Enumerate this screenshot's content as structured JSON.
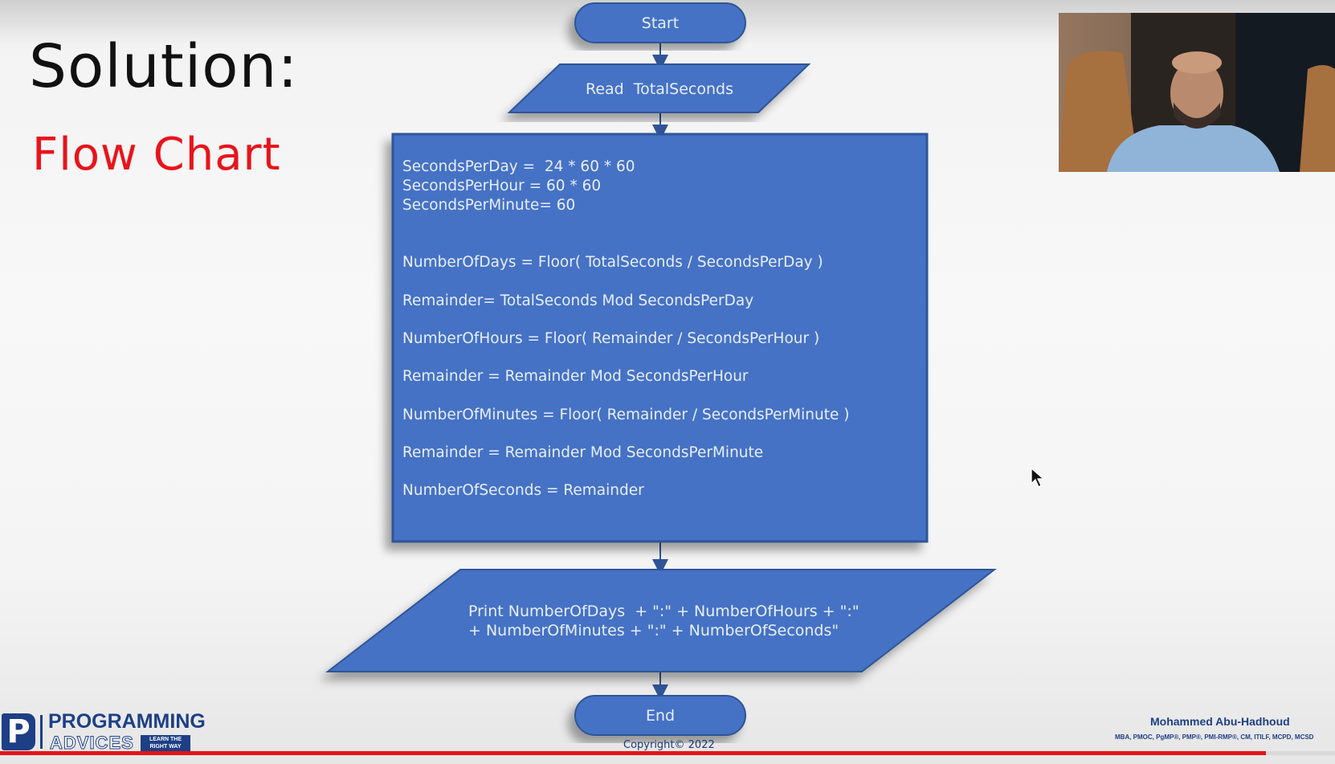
{
  "slide": {
    "title": "Solution:",
    "subtitle": "Flow Chart"
  },
  "flowchart": {
    "start": "Start",
    "input": "Read  TotalSeconds",
    "process": {
      "constants": [
        "SecondsPerDay =  24 * 60 * 60",
        "SecondsPerHour = 60 * 60",
        "SecondsPerMinute= 60"
      ],
      "steps": [
        "NumberOfDays = Floor( TotalSeconds / SecondsPerDay )",
        "Remainder= TotalSeconds Mod SecondsPerDay",
        "NumberOfHours = Floor( Remainder / SecondsPerHour )",
        "Remainder = Remainder Mod SecondsPerHour",
        "NumberOfMinutes = Floor( Remainder / SecondsPerMinute )",
        "Remainder = Remainder Mod SecondsPerMinute",
        "NumberOfSeconds = Remainder"
      ]
    },
    "output": [
      "Print NumberOfDays  + \":\" + NumberOfHours + \":\"",
      "+ NumberOfMinutes + \":\" + NumberOfSeconds\""
    ],
    "end": "End"
  },
  "branding": {
    "logo_top": "PROGRAMMING",
    "logo_bottom": "ADVICES",
    "logo_badge": "LEARN THE RIGHT WAY",
    "presenter_name": "Mohammed Abu-Hadhoud",
    "presenter_credentials": "MBA, PMOC, PgMP®, PMP®, PMI-RMP®, CM, ITILF, MCPD, MCSD",
    "copyright": "Copyright© 2022"
  },
  "video": {
    "progress": 0.948
  },
  "colors": {
    "shape_fill": "#4472c4",
    "shape_border": "#2f5597",
    "title_color": "#111111",
    "subtitle_color": "#e8141b",
    "progress_color": "#e41414",
    "brand_blue": "#1d3f86"
  },
  "icons": {
    "cursor": "mouse-pointer-icon"
  }
}
